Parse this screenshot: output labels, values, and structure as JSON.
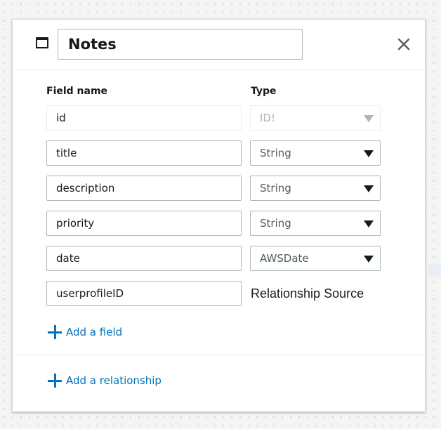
{
  "model": {
    "name": "Notes",
    "column_headers": {
      "field_name": "Field name",
      "type": "Type"
    },
    "fields": [
      {
        "name": "id",
        "type": "ID!",
        "type_editable": false
      },
      {
        "name": "title",
        "type": "String",
        "type_editable": true
      },
      {
        "name": "description",
        "type": "String",
        "type_editable": true
      },
      {
        "name": "priority",
        "type": "String",
        "type_editable": true
      },
      {
        "name": "date",
        "type": "AWSDate",
        "type_editable": true
      },
      {
        "name": "userprofileID",
        "type": "Relationship Source",
        "type_editable": false
      }
    ],
    "add_field_label": "Add a field",
    "add_relationship_label": "Add a relationship"
  },
  "icons": {
    "model": "window-icon",
    "close": "close-icon",
    "add_field": "plus-icon",
    "add_relationship": "plus-icon"
  },
  "colors": {
    "link": "#0073bb",
    "text": "#16191f",
    "border": "#aab7b8",
    "disabled": "#aab7b8"
  }
}
